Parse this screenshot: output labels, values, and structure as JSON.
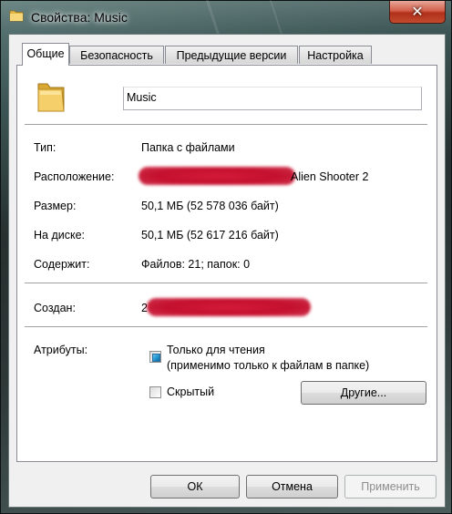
{
  "window": {
    "title": "Свойства: Music",
    "close_glyph": "✕"
  },
  "tabs": [
    {
      "label": "Общие",
      "active": true
    },
    {
      "label": "Безопасность",
      "active": false
    },
    {
      "label": "Предыдущие версии",
      "active": false
    },
    {
      "label": "Настройка",
      "active": false
    }
  ],
  "general": {
    "folder_name": "Music",
    "folder_icon": "folder-icon",
    "type_label": "Тип:",
    "type_value": "Папка с файлами",
    "location_label": "Расположение:",
    "location_value_visible": "Alien Shooter 2",
    "size_label": "Размер:",
    "size_value": "50,1 МБ (52 578 036 байт)",
    "disk_label": "На диске:",
    "disk_value": "50,1 МБ (52 617 216 байт)",
    "contains_label": "Содержит:",
    "contains_value": "Файлов: 21; папок: 0",
    "created_label": "Создан:",
    "created_value_visible": "2",
    "attributes_label": "Атрибуты:",
    "readonly_label_line1": "Только для чтения",
    "readonly_label_line2": "(применимо только к файлам в папке)",
    "readonly_state": "indeterminate",
    "hidden_label": "Скрытый",
    "hidden_checked": false,
    "other_button": "Другие..."
  },
  "footer": {
    "ok": "ОК",
    "cancel": "Отмена",
    "apply": "Применить"
  },
  "colors": {
    "redaction": "#c81432",
    "close_button": "#c24a2f"
  }
}
